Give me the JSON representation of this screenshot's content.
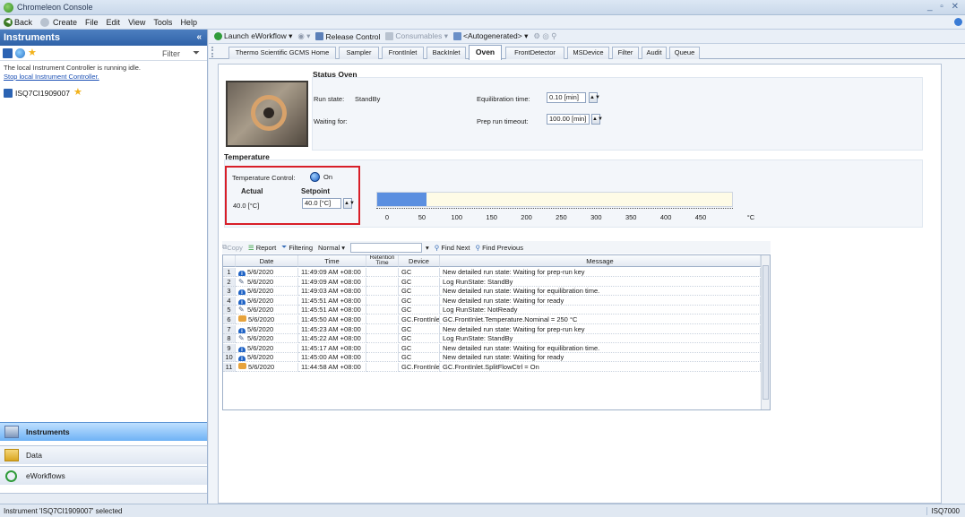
{
  "window": {
    "title": "Chromeleon Console",
    "controls": "_ ▫ ✕"
  },
  "menubar": {
    "back": "Back",
    "create": "Create",
    "file": "File",
    "edit": "Edit",
    "view": "View",
    "tools": "Tools",
    "help": "Help"
  },
  "left_panel": {
    "header": "Instruments",
    "collapse": "«",
    "filter_label": "Filter",
    "message": "The local Instrument Controller is running idle.",
    "stop_link": "Stop local Instrument Controller.",
    "instrument": "ISQ7CI1909007",
    "nav": [
      "Instruments",
      "Data",
      "eWorkflows"
    ]
  },
  "workflow_toolbar": {
    "launch": "Launch eWorkflow ▾",
    "release": "Release Control",
    "consumables": "Consumables ▾",
    "autogen": "<Autogenerated> ▾"
  },
  "tabs": [
    "Thermo Scientific GCMS Home",
    "Sampler",
    "FrontInlet",
    "BackInlet",
    "Oven",
    "FrontDetector",
    "MSDevice",
    "Filter",
    "Audit",
    "Queue"
  ],
  "active_tab": "Oven",
  "status_oven": {
    "title": "Status Oven",
    "run_state_label": "Run state:",
    "run_state_value": "StandBy",
    "waiting_label": "Waiting for:",
    "equil_label": "Equilibration time:",
    "equil_value": "0.10 [min]",
    "prep_label": "Prep run timeout:",
    "prep_value": "100.00 [min]"
  },
  "temperature": {
    "title": "Temperature",
    "control_label": "Temperature Control:",
    "control_value": "On",
    "actual_label": "Actual",
    "actual_value": "40.0 [°C]",
    "setpoint_label": "Setpoint",
    "setpoint_value": "40.0 [°C]",
    "gauge_value": 40,
    "gauge_max": 450,
    "gauge_ticks": [
      "0",
      "50",
      "100",
      "150",
      "200",
      "250",
      "300",
      "350",
      "400",
      "450"
    ],
    "gauge_unit": "°C"
  },
  "log_toolbar": {
    "copy": "Copy",
    "report": "Report",
    "filtering": "Filtering",
    "normal": "Normal ▾",
    "find_next": "Find Next",
    "find_prev": "Find Previous"
  },
  "log_table": {
    "headers": [
      "Date",
      "Time",
      "Retention Time",
      "Device",
      "Message"
    ],
    "rows": [
      {
        "n": "1",
        "type": "info",
        "date": "5/6/2020",
        "time": "11:49:09 AM +08:00",
        "device": "GC",
        "message": "New detailed run state: Waiting for prep-run  key"
      },
      {
        "n": "2",
        "type": "log",
        "date": "5/6/2020",
        "time": "11:49:09 AM +08:00",
        "device": "GC",
        "message": "Log RunState: StandBy"
      },
      {
        "n": "3",
        "type": "info",
        "date": "5/6/2020",
        "time": "11:49:03 AM +08:00",
        "device": "GC",
        "message": "New detailed run state: Waiting for equilibration time."
      },
      {
        "n": "4",
        "type": "info",
        "date": "5/6/2020",
        "time": "11:45:51 AM +08:00",
        "device": "GC",
        "message": "New detailed run state: Waiting for ready"
      },
      {
        "n": "5",
        "type": "log",
        "date": "5/6/2020",
        "time": "11:45:51 AM +08:00",
        "device": "GC",
        "message": "Log RunState: NotReady"
      },
      {
        "n": "6",
        "type": "hand",
        "date": "5/6/2020",
        "time": "11:45:50 AM +08:00",
        "device": "GC.FrontInlet",
        "message": "GC.FrontInlet.Temperature.Nominal = 250 °C"
      },
      {
        "n": "7",
        "type": "info",
        "date": "5/6/2020",
        "time": "11:45:23 AM +08:00",
        "device": "GC",
        "message": "New detailed run state: Waiting for prep-run  key"
      },
      {
        "n": "8",
        "type": "log",
        "date": "5/6/2020",
        "time": "11:45:22 AM +08:00",
        "device": "GC",
        "message": "Log RunState: StandBy"
      },
      {
        "n": "9",
        "type": "info",
        "date": "5/6/2020",
        "time": "11:45:17 AM +08:00",
        "device": "GC",
        "message": "New detailed run state: Waiting for equilibration time."
      },
      {
        "n": "10",
        "type": "info",
        "date": "5/6/2020",
        "time": "11:45:00 AM +08:00",
        "device": "GC",
        "message": "New detailed run state: Waiting for ready"
      },
      {
        "n": "11",
        "type": "hand",
        "date": "5/6/2020",
        "time": "11:44:58 AM +08:00",
        "device": "GC.FrontInlet",
        "message": "GC.FrontInlet.SplitFlowCtrl = On"
      }
    ]
  },
  "statusbar": {
    "left": "Instrument 'ISQ7CI1909007' selected",
    "right": "ISQ7000"
  },
  "colors": {
    "accent": "#2f62a8",
    "highlight": "#d81e28",
    "gauge_fill": "#5b8fe0"
  }
}
